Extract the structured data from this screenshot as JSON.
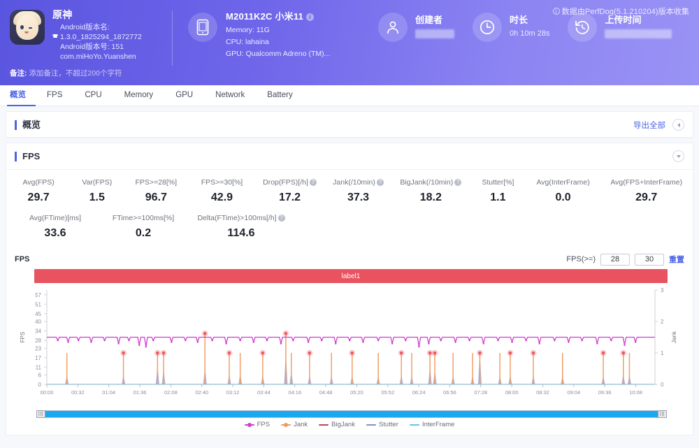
{
  "header": {
    "collect_note": "数据由PerfDog(5.1.210204)版本收集",
    "app": {
      "name": "原神",
      "version_name_label": "Android版本名:",
      "version_name": "1.3.0_1825294_1872772",
      "version_code": "Android版本号: 151",
      "package": "com.miHoYo.Yuanshen",
      "note_label": "备注:",
      "note_placeholder": "添加备注，不超过200个字符"
    },
    "device": {
      "model": "M2011K2C 小米11",
      "memory": "Memory: 11G",
      "cpu": "CPU: lahaina",
      "gpu": "GPU: Qualcomm Adreno (TM)..."
    },
    "creator": {
      "title": "创建者",
      "value": ""
    },
    "duration": {
      "title": "时长",
      "value": "0h 10m 28s"
    },
    "upload": {
      "title": "上传时间",
      "value": ""
    }
  },
  "tabs": [
    {
      "label": "概览",
      "active": true
    },
    {
      "label": "FPS",
      "active": false
    },
    {
      "label": "CPU",
      "active": false
    },
    {
      "label": "Memory",
      "active": false
    },
    {
      "label": "GPU",
      "active": false
    },
    {
      "label": "Network",
      "active": false
    },
    {
      "label": "Battery",
      "active": false
    }
  ],
  "overview_panel": {
    "title": "概览",
    "export_label": "导出全部"
  },
  "fps_panel": {
    "title": "FPS",
    "metrics_row1": [
      {
        "label": "Avg(FPS)",
        "value": "29.7",
        "help": false
      },
      {
        "label": "Var(FPS)",
        "value": "1.5",
        "help": false
      },
      {
        "label": "FPS>=28[%]",
        "value": "96.7",
        "help": false
      },
      {
        "label": "FPS>=30[%]",
        "value": "42.9",
        "help": false
      },
      {
        "label": "Drop(FPS)[/h]",
        "value": "17.2",
        "help": true
      },
      {
        "label": "Jank(/10min)",
        "value": "37.3",
        "help": true
      },
      {
        "label": "BigJank(/10min)",
        "value": "18.2",
        "help": true
      },
      {
        "label": "Stutter[%]",
        "value": "1.1",
        "help": false
      },
      {
        "label": "Avg(InterFrame)",
        "value": "0.0",
        "help": false
      },
      {
        "label": "Avg(FPS+InterFrame)",
        "value": "29.7",
        "help": false
      }
    ],
    "metrics_row2": [
      {
        "label": "Avg(FTime)[ms]",
        "value": "33.6",
        "help": false
      },
      {
        "label": "FTime>=100ms[%]",
        "value": "0.2",
        "help": false
      },
      {
        "label": "Delta(FTime)>100ms[/h]",
        "value": "114.6",
        "help": true
      }
    ],
    "chart_header_label": "FPS",
    "threshold_label": "FPS(>=)",
    "threshold_1": "28",
    "threshold_2": "30",
    "reset_label": "重置",
    "label_bar_text": "label1"
  },
  "chart_data": {
    "type": "line",
    "title": "FPS",
    "xlabel": "",
    "ylabel": "FPS",
    "y2label": "Jank",
    "grid": false,
    "legend_position": "bottom",
    "yticks": [
      0,
      6,
      11,
      17,
      23,
      28,
      34,
      40,
      45,
      51,
      57
    ],
    "ylim": [
      0,
      60
    ],
    "y2ticks": [
      0,
      1,
      2,
      3
    ],
    "y2lim": [
      0,
      3
    ],
    "xticks": [
      "00:00",
      "00:32",
      "01:04",
      "01:36",
      "02:08",
      "02:40",
      "03:12",
      "03:44",
      "04:16",
      "04:48",
      "05:20",
      "05:52",
      "06:24",
      "06:56",
      "07:28",
      "08:00",
      "08:32",
      "09:04",
      "09:36",
      "10:08"
    ],
    "xlim": [
      "00:00",
      "10:20"
    ],
    "colors": {
      "fps": "#d03fd0",
      "jank": "#f2995e",
      "bigjank": "#b5485c",
      "stutter": "#8090c8",
      "interframe": "#5fc8de",
      "label_bar": "#e8535f",
      "accent": "#4a63e7"
    },
    "series": [
      {
        "name": "FPS",
        "color": "#d03fd0",
        "baseline": 30,
        "dips": [
          {
            "t": 0.018,
            "v": 28
          },
          {
            "t": 0.035,
            "v": 27
          },
          {
            "t": 0.052,
            "v": 28
          },
          {
            "t": 0.073,
            "v": 27
          },
          {
            "t": 0.095,
            "v": 28
          },
          {
            "t": 0.118,
            "v": 26
          },
          {
            "t": 0.135,
            "v": 28
          },
          {
            "t": 0.152,
            "v": 25
          },
          {
            "t": 0.163,
            "v": 24
          },
          {
            "t": 0.175,
            "v": 28
          },
          {
            "t": 0.205,
            "v": 27
          },
          {
            "t": 0.228,
            "v": 28
          },
          {
            "t": 0.248,
            "v": 27
          },
          {
            "t": 0.272,
            "v": 28
          },
          {
            "t": 0.295,
            "v": 26
          },
          {
            "t": 0.318,
            "v": 28
          },
          {
            "t": 0.34,
            "v": 27
          },
          {
            "t": 0.362,
            "v": 28
          },
          {
            "t": 0.385,
            "v": 26
          },
          {
            "t": 0.405,
            "v": 28
          },
          {
            "t": 0.43,
            "v": 27
          },
          {
            "t": 0.452,
            "v": 28
          },
          {
            "t": 0.475,
            "v": 26
          },
          {
            "t": 0.498,
            "v": 28
          },
          {
            "t": 0.52,
            "v": 27
          },
          {
            "t": 0.545,
            "v": 28
          },
          {
            "t": 0.568,
            "v": 26
          },
          {
            "t": 0.59,
            "v": 28
          },
          {
            "t": 0.612,
            "v": 24
          },
          {
            "t": 0.628,
            "v": 26
          },
          {
            "t": 0.648,
            "v": 28
          },
          {
            "t": 0.672,
            "v": 27
          },
          {
            "t": 0.695,
            "v": 28
          },
          {
            "t": 0.718,
            "v": 26
          },
          {
            "t": 0.742,
            "v": 28
          },
          {
            "t": 0.765,
            "v": 27
          },
          {
            "t": 0.788,
            "v": 28
          },
          {
            "t": 0.81,
            "v": 26
          },
          {
            "t": 0.835,
            "v": 28
          },
          {
            "t": 0.858,
            "v": 27
          },
          {
            "t": 0.88,
            "v": 28
          },
          {
            "t": 0.905,
            "v": 26
          },
          {
            "t": 0.928,
            "v": 28
          },
          {
            "t": 0.95,
            "v": 25
          },
          {
            "t": 0.968,
            "v": 27
          }
        ]
      },
      {
        "name": "Jank",
        "color": "#f2995e",
        "spikes": [
          {
            "t": 0.033,
            "v": 1
          },
          {
            "t": 0.126,
            "v": 1
          },
          {
            "t": 0.182,
            "v": 1
          },
          {
            "t": 0.192,
            "v": 1
          },
          {
            "t": 0.26,
            "v": 2
          },
          {
            "t": 0.3,
            "v": 1
          },
          {
            "t": 0.318,
            "v": 1
          },
          {
            "t": 0.355,
            "v": 1
          },
          {
            "t": 0.393,
            "v": 2
          },
          {
            "t": 0.402,
            "v": 1
          },
          {
            "t": 0.432,
            "v": 1
          },
          {
            "t": 0.468,
            "v": 1
          },
          {
            "t": 0.502,
            "v": 1
          },
          {
            "t": 0.545,
            "v": 1
          },
          {
            "t": 0.583,
            "v": 1
          },
          {
            "t": 0.6,
            "v": 1
          },
          {
            "t": 0.63,
            "v": 1
          },
          {
            "t": 0.638,
            "v": 1
          },
          {
            "t": 0.668,
            "v": 1
          },
          {
            "t": 0.7,
            "v": 1
          },
          {
            "t": 0.712,
            "v": 1
          },
          {
            "t": 0.745,
            "v": 1
          },
          {
            "t": 0.762,
            "v": 1
          },
          {
            "t": 0.8,
            "v": 1
          },
          {
            "t": 0.848,
            "v": 1
          },
          {
            "t": 0.915,
            "v": 1
          },
          {
            "t": 0.948,
            "v": 1
          },
          {
            "t": 0.958,
            "v": 1
          }
        ]
      },
      {
        "name": "BigJank",
        "color": "#b5485c",
        "spikes": [
          {
            "t": 0.126,
            "v": 1
          },
          {
            "t": 0.182,
            "v": 1
          },
          {
            "t": 0.192,
            "v": 1
          },
          {
            "t": 0.26,
            "v": 1
          },
          {
            "t": 0.3,
            "v": 1
          },
          {
            "t": 0.355,
            "v": 1
          },
          {
            "t": 0.393,
            "v": 1
          },
          {
            "t": 0.432,
            "v": 1
          },
          {
            "t": 0.502,
            "v": 1
          },
          {
            "t": 0.583,
            "v": 1
          },
          {
            "t": 0.63,
            "v": 1
          },
          {
            "t": 0.638,
            "v": 1
          },
          {
            "t": 0.712,
            "v": 1
          },
          {
            "t": 0.762,
            "v": 1
          },
          {
            "t": 0.8,
            "v": 1
          },
          {
            "t": 0.915,
            "v": 1
          },
          {
            "t": 0.948,
            "v": 1
          }
        ]
      },
      {
        "name": "Stutter",
        "color": "#8090c8",
        "spikes": [
          {
            "t": 0.033,
            "v": 0.3
          },
          {
            "t": 0.126,
            "v": 0.3
          },
          {
            "t": 0.182,
            "v": 0.6
          },
          {
            "t": 0.192,
            "v": 0.48
          },
          {
            "t": 0.26,
            "v": 0.55
          },
          {
            "t": 0.3,
            "v": 0.33
          },
          {
            "t": 0.318,
            "v": 0.33
          },
          {
            "t": 0.355,
            "v": 0.3
          },
          {
            "t": 0.393,
            "v": 1.0
          },
          {
            "t": 0.402,
            "v": 0.42
          },
          {
            "t": 0.432,
            "v": 0.3
          },
          {
            "t": 0.468,
            "v": 0.28
          },
          {
            "t": 0.502,
            "v": 0.3
          },
          {
            "t": 0.545,
            "v": 0.28
          },
          {
            "t": 0.583,
            "v": 0.3
          },
          {
            "t": 0.6,
            "v": 0.28
          },
          {
            "t": 0.63,
            "v": 0.55
          },
          {
            "t": 0.638,
            "v": 0.45
          },
          {
            "t": 0.668,
            "v": 0.3
          },
          {
            "t": 0.7,
            "v": 0.28
          },
          {
            "t": 0.712,
            "v": 1.0
          },
          {
            "t": 0.745,
            "v": 0.28
          },
          {
            "t": 0.762,
            "v": 0.3
          },
          {
            "t": 0.8,
            "v": 0.3
          },
          {
            "t": 0.848,
            "v": 0.28
          },
          {
            "t": 0.915,
            "v": 0.28
          },
          {
            "t": 0.948,
            "v": 0.33
          },
          {
            "t": 0.958,
            "v": 0.3
          }
        ]
      },
      {
        "name": "InterFrame",
        "color": "#5fc8de",
        "values_constant": 0
      }
    ],
    "legend": [
      {
        "label": "FPS",
        "color": "#d03fd0",
        "marker": "dot-line"
      },
      {
        "label": "Jank",
        "color": "#f2995e",
        "marker": "dot-line"
      },
      {
        "label": "BigJank",
        "color": "#b5485c",
        "marker": "line"
      },
      {
        "label": "Stutter",
        "color": "#8090c8",
        "marker": "line"
      },
      {
        "label": "InterFrame",
        "color": "#5fc8de",
        "marker": "line"
      }
    ]
  }
}
